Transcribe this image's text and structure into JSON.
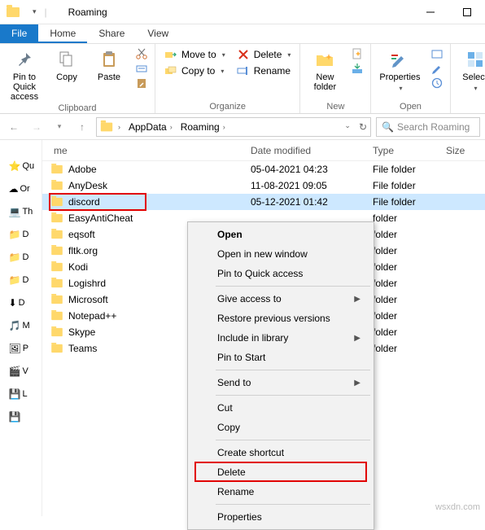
{
  "window": {
    "title": "Roaming"
  },
  "tabs": {
    "file": "File",
    "home": "Home",
    "share": "Share",
    "view": "View"
  },
  "ribbon": {
    "clipboard": {
      "label": "Clipboard",
      "pin": "Pin to Quick\naccess",
      "copy": "Copy",
      "paste": "Paste"
    },
    "organize": {
      "label": "Organize",
      "moveto": "Move to",
      "copyto": "Copy to",
      "delete": "Delete",
      "rename": "Rename"
    },
    "new": {
      "label": "New",
      "newfolder": "New\nfolder"
    },
    "open": {
      "label": "Open",
      "properties": "Properties"
    },
    "select": {
      "label": "Select"
    }
  },
  "addr": {
    "crumbs": [
      "AppData",
      "Roaming"
    ],
    "search_placeholder": "Search Roaming"
  },
  "columns": {
    "name": "me",
    "dm": "Date modified",
    "tp": "Type",
    "sz": "Size"
  },
  "rows": [
    {
      "name": "Adobe",
      "dm": "05-04-2021 04:23",
      "tp": "File folder"
    },
    {
      "name": "AnyDesk",
      "dm": "11-08-2021 09:05",
      "tp": "File folder"
    },
    {
      "name": "discord",
      "dm": "05-12-2021 01:42",
      "tp": "File folder",
      "selected": true
    },
    {
      "name": "EasyAntiCheat",
      "dm": "",
      "tp": "folder"
    },
    {
      "name": "eqsoft",
      "dm": "",
      "tp": "folder"
    },
    {
      "name": "fltk.org",
      "dm": "",
      "tp": "folder"
    },
    {
      "name": "Kodi",
      "dm": "",
      "tp": "folder"
    },
    {
      "name": "Logishrd",
      "dm": "",
      "tp": "folder"
    },
    {
      "name": "Microsoft",
      "dm": "",
      "tp": "folder"
    },
    {
      "name": "Notepad++",
      "dm": "",
      "tp": "folder"
    },
    {
      "name": "Skype",
      "dm": "",
      "tp": "folder"
    },
    {
      "name": "Teams",
      "dm": "",
      "tp": "folder"
    }
  ],
  "nav_items": [
    "Qu",
    "Or",
    "Th",
    "D",
    "D",
    "D",
    "D",
    "M",
    "P",
    "V",
    "L",
    ""
  ],
  "ctx": {
    "open": "Open",
    "open_new": "Open in new window",
    "pin_qa": "Pin to Quick access",
    "give_access": "Give access to",
    "restore": "Restore previous versions",
    "include": "Include in library",
    "pin_start": "Pin to Start",
    "send_to": "Send to",
    "cut": "Cut",
    "copy": "Copy",
    "shortcut": "Create shortcut",
    "delete": "Delete",
    "rename": "Rename",
    "properties": "Properties"
  },
  "watermark": "wsxdn.com"
}
